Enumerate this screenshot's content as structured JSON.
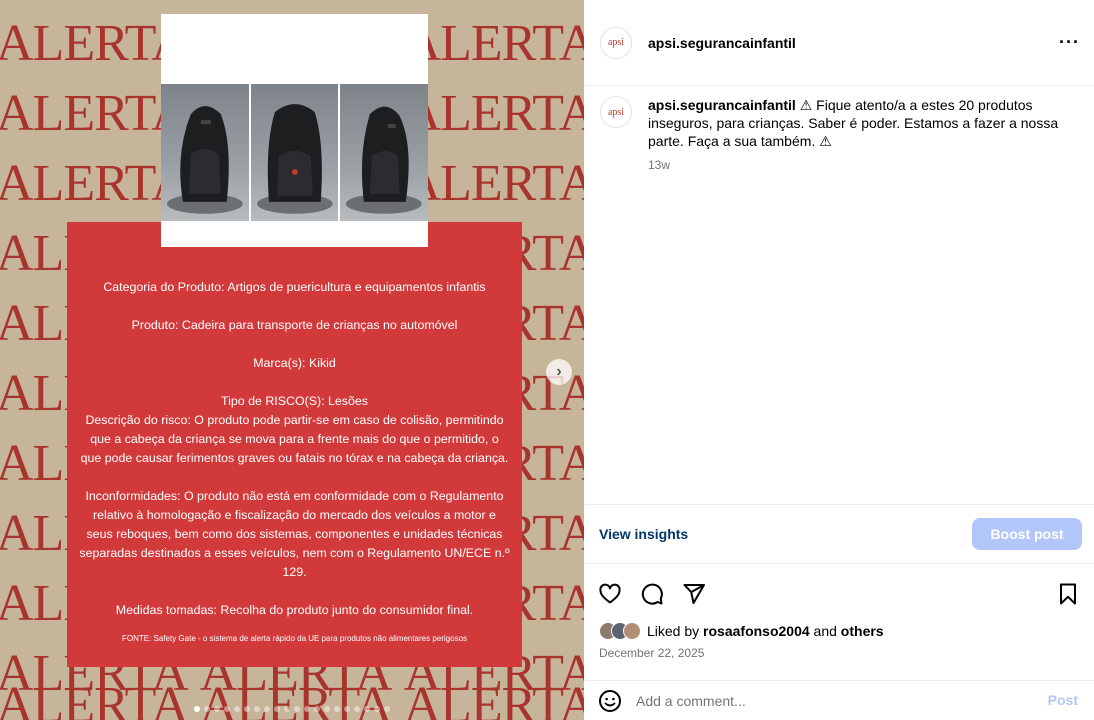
{
  "media": {
    "background_word": "ALERTA",
    "info": {
      "category": "Categoria do Produto: Artigos de puericultura e equipamentos infantis",
      "product": "Produto: Cadeira para transporte de crianças no automóvel",
      "brand": "Marca(s): Kikid",
      "risk_type": "Tipo de RISCO(S): Lesões",
      "risk_description": "Descrição do risco: O produto pode partir-se em caso de colisão, permitindo que a cabeça da criança se mova para a frente mais do que o permitido, o que pode causar ferimentos graves ou fatais no tórax e na cabeça da criança.",
      "nonconformities": "Inconformidades: O produto não está em conformidade com o Regulamento relativo à homologação e fiscalização do mercado dos veículos a motor e seus reboques, bem como dos sistemas, componentes e unidades técnicas separadas destinados a esses veículos, nem com o Regulamento UN/ECE n.º 129.",
      "measures": "Medidas tomadas: Recolha do produto junto do consumidor final.",
      "source": "FONTE: Safety Gate - o sistema de alerta rápido da UE para produtos não alimentares perigosos"
    },
    "slide_count": 20,
    "active_slide": 1
  },
  "header": {
    "avatar_text": "apsi",
    "username": "apsi.segurancainfantil",
    "more_label": "···"
  },
  "caption": {
    "username": "apsi.segurancainfantil",
    "text": "⚠ Fique atento/a a estes 20 produtos inseguros, para crianças. Saber é poder. Estamos a fazer a nossa parte. Faça a sua também. ⚠",
    "age": "13w"
  },
  "insights": {
    "view_label": "View insights",
    "boost_label": "Boost post"
  },
  "likes": {
    "prefix": "Liked by ",
    "user": "rosaafonso2004",
    "middle": " and ",
    "others": "others"
  },
  "post_date": "December 22, 2025",
  "comment": {
    "placeholder": "Add a comment...",
    "post_label": "Post"
  },
  "colors": {
    "alert_red": "#d2393a",
    "beige": "#c7b59a",
    "link_blue": "#00376b",
    "boost_blue": "#b2c6fa"
  }
}
